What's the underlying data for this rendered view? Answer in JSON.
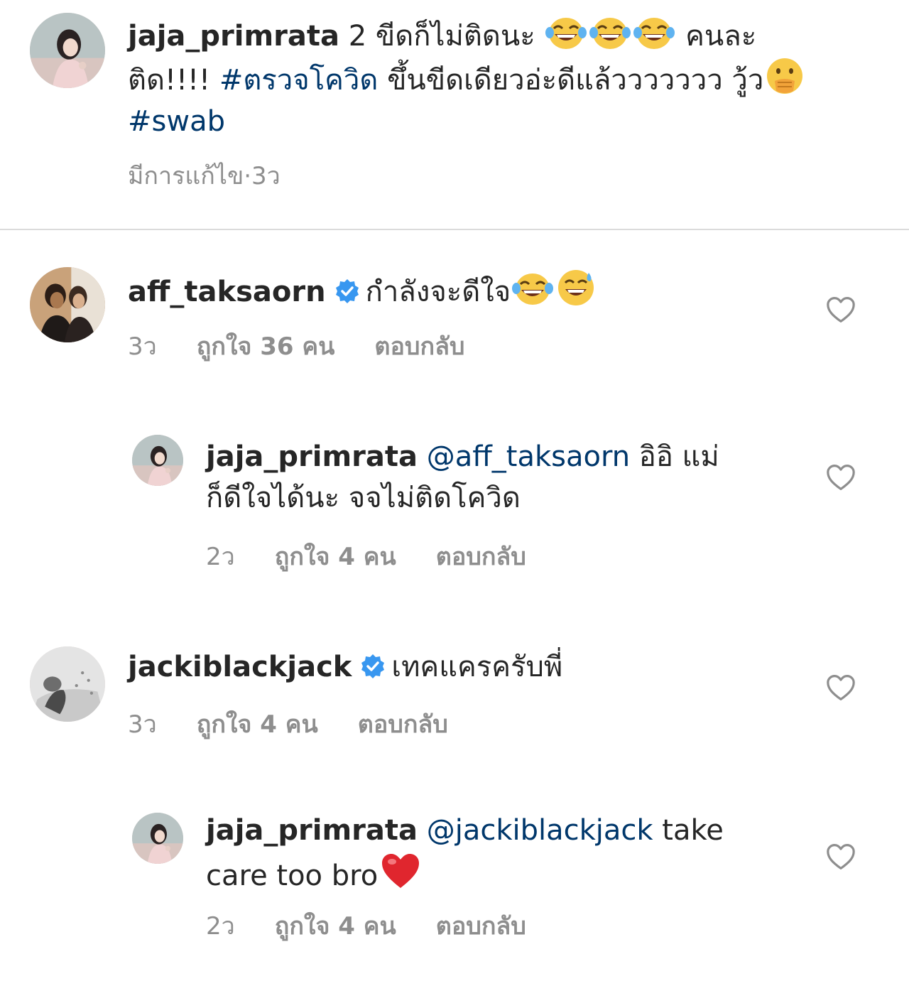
{
  "caption": {
    "username": "jaja_primrata",
    "text_part1": " 2 ขีดก็ไม่ติดนะ ",
    "text_part2": " คนละ",
    "text_part3": "ติด!!!! ",
    "hashtag1": "#ตรวจโควิด",
    "text_part4": " ขึ้นขีดเดียวอ่ะดีแล้ววววววว วู้ว",
    "hashtag2": "#swab",
    "edited": "มีการแก้ไข",
    "separator": " · ",
    "time": "3ว"
  },
  "comments": [
    {
      "username": "aff_taksaorn",
      "verified": true,
      "text": "กำลังจะดีใจ",
      "time": "3ว",
      "likes": "ถูกใจ 36 คน",
      "reply": "ตอบกลับ"
    },
    {
      "username": "jaja_primrata",
      "mention": "@aff_taksaorn",
      "text_line1": " อิอิ แม่",
      "text_line2": "ก็ดีใจได้นะ จจไม่ติดโควิด",
      "time": "2ว",
      "likes": "ถูกใจ 4 คน",
      "reply": "ตอบกลับ"
    },
    {
      "username": "jackiblackjack",
      "verified": true,
      "text": "เทคแครครับพี่",
      "time": "3ว",
      "likes": "ถูกใจ 4 คน",
      "reply": "ตอบกลับ"
    },
    {
      "username": "jaja_primrata",
      "mention": "@jackiblackjack",
      "text_line1": " take",
      "text_line2": "care too bro",
      "time": "2ว",
      "likes": "ถูกใจ 4 คน",
      "reply": "ตอบกลับ"
    }
  ],
  "icons": {
    "like": "heart-outline-icon",
    "verified": "verified-badge-icon",
    "emoji_laugh": "face-with-tears-of-joy-icon",
    "emoji_sweat": "grinning-face-with-sweat-icon",
    "emoji_hand": "face-with-hand-over-mouth-icon",
    "emoji_heart": "red-heart-icon"
  },
  "colors": {
    "text": "#262626",
    "secondary": "#8e8e8e",
    "link": "#00376b",
    "verified": "#3897f0",
    "divider": "#dbdbdb"
  }
}
